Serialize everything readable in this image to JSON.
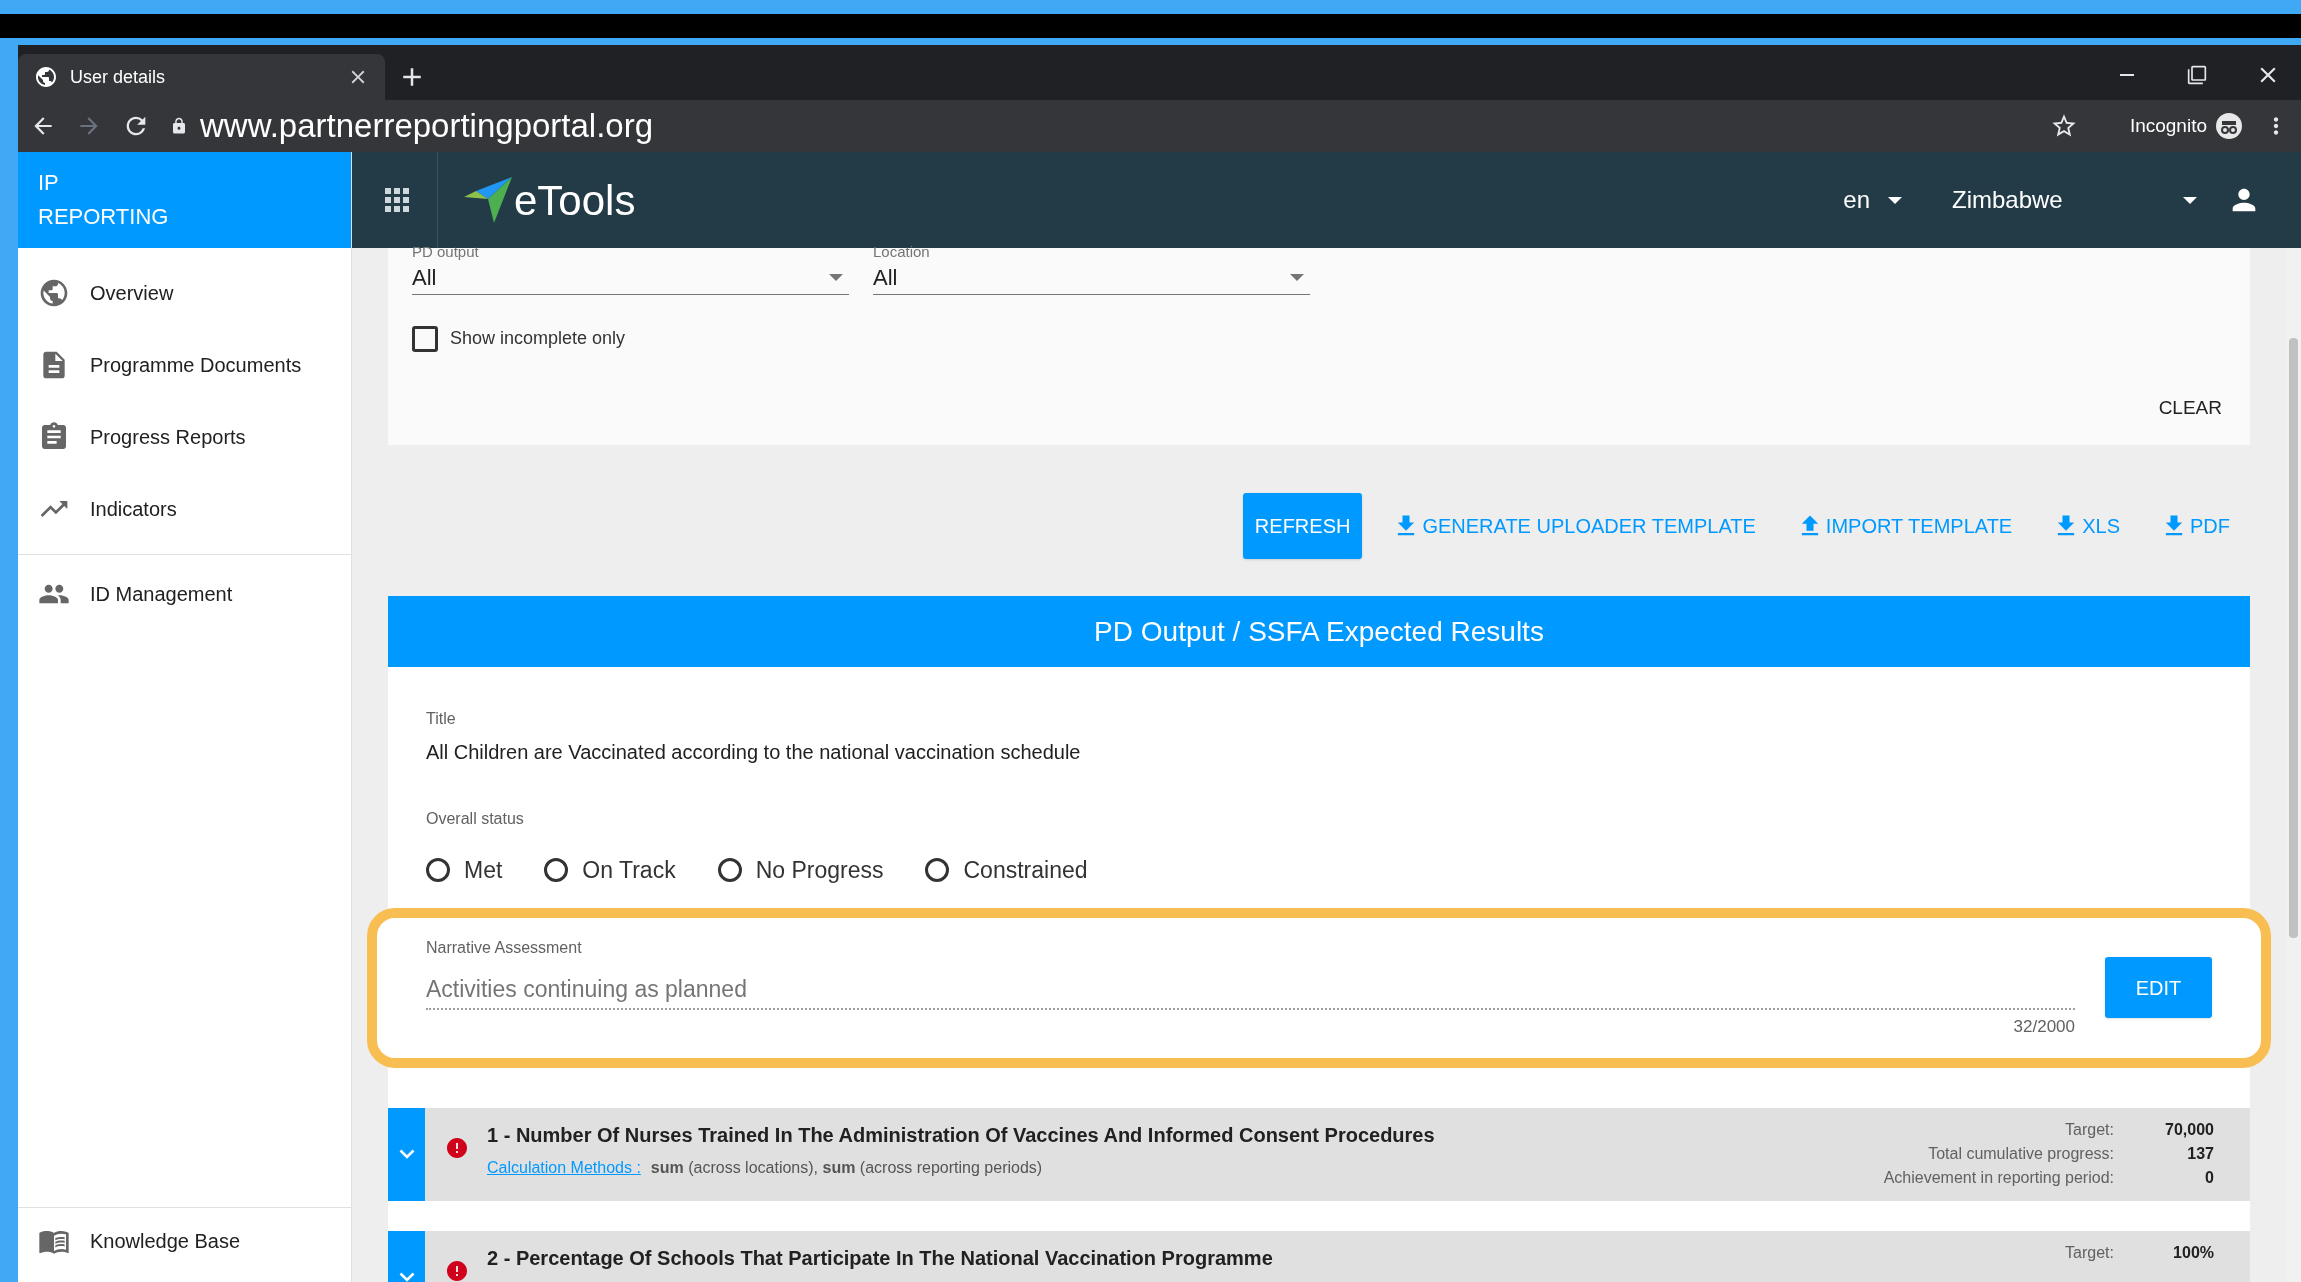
{
  "browser": {
    "tab_title": "User details",
    "url": "www.partnerreportingportal.org",
    "incognito_label": "Incognito"
  },
  "sidebar": {
    "brand": "IP REPORTING",
    "items": [
      {
        "label": "Overview"
      },
      {
        "label": "Programme Documents"
      },
      {
        "label": "Progress Reports"
      },
      {
        "label": "Indicators"
      },
      {
        "label": "ID Management"
      }
    ],
    "footer_item": {
      "label": "Knowledge Base"
    }
  },
  "header": {
    "logo": "eTools",
    "language": "en",
    "country": "Zimbabwe"
  },
  "filters": {
    "fields": [
      {
        "label": "PD output",
        "value": "All"
      },
      {
        "label": "Location",
        "value": "All"
      }
    ],
    "checkbox": {
      "label": "Show incomplete only",
      "checked": false
    },
    "clear": "CLEAR"
  },
  "actions": [
    {
      "label": "REFRESH",
      "kind": "primary"
    },
    {
      "label": "GENERATE UPLOADER TEMPLATE",
      "kind": "download"
    },
    {
      "label": "IMPORT TEMPLATE",
      "kind": "upload"
    },
    {
      "label": "XLS",
      "kind": "download"
    },
    {
      "label": "PDF",
      "kind": "download"
    }
  ],
  "results": {
    "heading": "PD Output / SSFA Expected Results",
    "title_label": "Title",
    "title": "All Children are Vaccinated according to the national vaccination schedule",
    "status_label": "Overall status",
    "statuses": [
      {
        "label": "Met",
        "selected": false
      },
      {
        "label": "On Track",
        "selected": false
      },
      {
        "label": "No Progress",
        "selected": false
      },
      {
        "label": "Constrained",
        "selected": false
      }
    ],
    "narrative": {
      "label": "Narrative Assessment",
      "value": "Activities continuing as planned",
      "counter": "32/2000",
      "button": "EDIT"
    }
  },
  "indicators": [
    {
      "title": "1 - Number Of Nurses Trained In The Administration Of Vaccines And Informed Consent Procedures",
      "calculation_link": "Calculation Methods :",
      "calculation": "**sum** (across locations), **sum** (across reporting periods)",
      "stats": [
        {
          "label": "Target:",
          "value": "70,000"
        },
        {
          "label": "Total cumulative progress:",
          "value": "137"
        },
        {
          "label": "Achievement in reporting period:",
          "value": "0"
        }
      ]
    },
    {
      "title": "2 - Percentage Of Schools That Participate In The National Vaccination Programme",
      "stats": [
        {
          "label": "Target:",
          "value": "100%"
        }
      ]
    }
  ]
}
